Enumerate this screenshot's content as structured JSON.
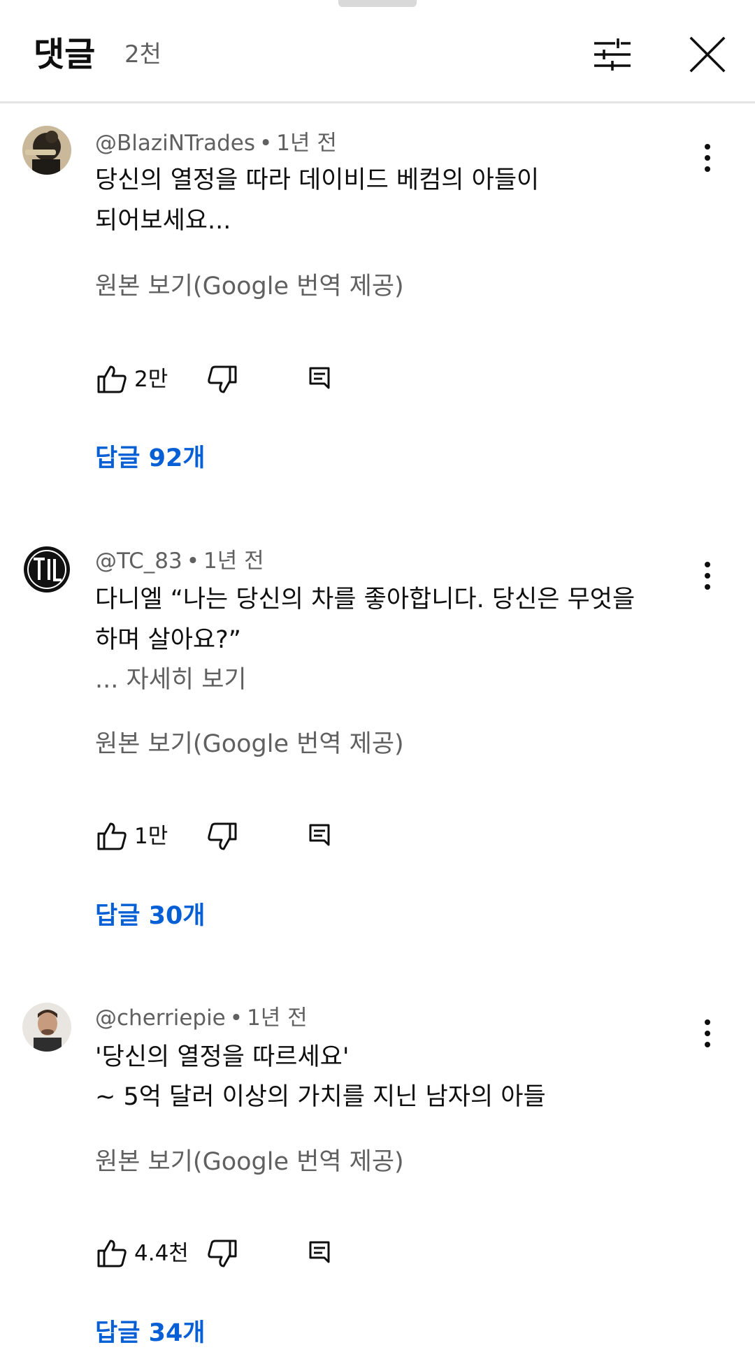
{
  "header": {
    "title": "댓글",
    "count": "2천"
  },
  "comments": [
    {
      "author": "@BlaziNTrades",
      "time": "1년 전",
      "lines": [
        "당신의 열정을 따라 데이비드 베컴의 아들이",
        "되어보세요..."
      ],
      "read_more": "",
      "translate_label": "원본 보기(Google 번역 제공)",
      "likes": "2만",
      "replies_label": "답글 92개",
      "avatar_icon": "avatar-photo-icon"
    },
    {
      "author": "@TC_83",
      "time": "1년 전",
      "lines": [
        "다니엘 “나는 당신의 차를 좋아합니다. 당신은 무엇을",
        "하며 살아요?”"
      ],
      "read_more": "... 자세히 보기",
      "translate_label": "원본 보기(Google 번역 제공)",
      "likes": "1만",
      "replies_label": "답글 30개",
      "avatar_icon": "avatar-logo-icon"
    },
    {
      "author": "@cherriepie",
      "time": "1년 전",
      "lines": [
        "'당신의 열정을 따르세요'",
        "~ 5억 달러 이상의 가치를 지닌 남자의 아들"
      ],
      "read_more": "",
      "translate_label": "원본 보기(Google 번역 제공)",
      "likes": "4.4천",
      "replies_label": "답글 34개",
      "avatar_icon": "avatar-photo-icon"
    }
  ],
  "colors": {
    "text_primary": "#0f0f0f",
    "text_secondary": "#606060",
    "link_blue": "#065fd4",
    "divider": "#e5e5e5"
  },
  "icons": [
    "filter-icon",
    "close-icon",
    "more-vert-icon",
    "thumb-up-icon",
    "thumb-down-icon",
    "reply-icon"
  ]
}
